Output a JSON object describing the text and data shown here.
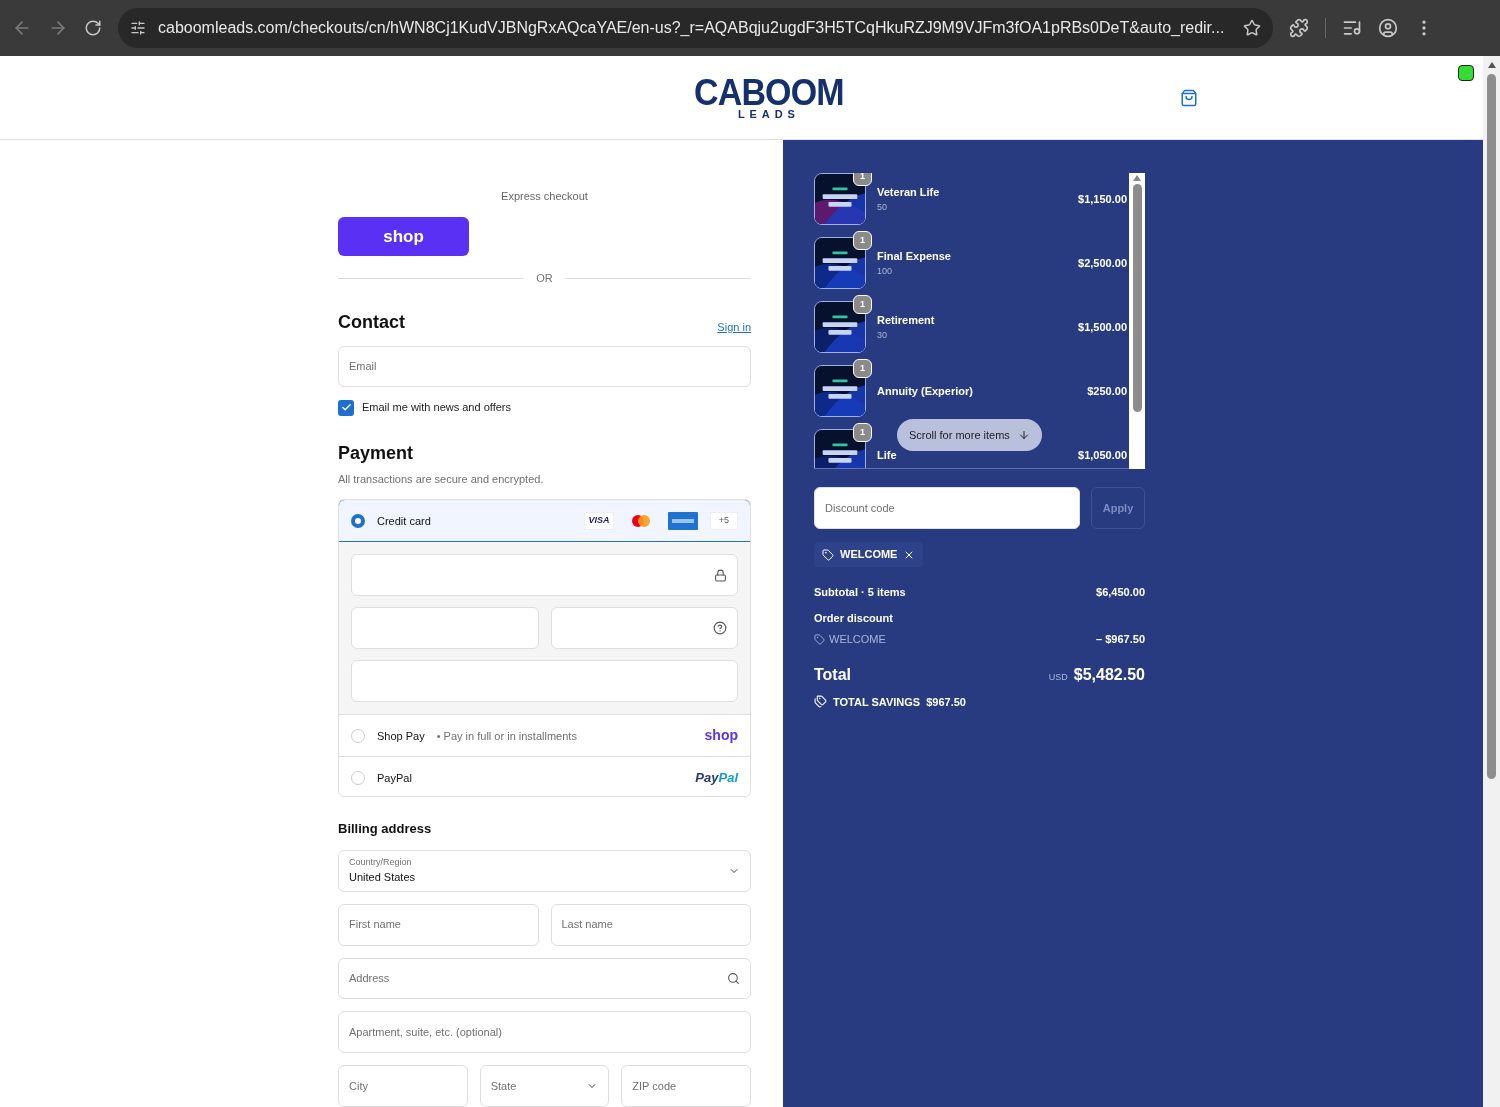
{
  "browser": {
    "url": "caboomleads.com/checkouts/cn/hWN8Cj1KudVJBNgRxAQcaYAE/en-us?_r=AQABqju2ugdF3H5TCqHkuRZJ9M9VJFm3fOA1pRBs0DeT&auto_redir..."
  },
  "header": {
    "logo_top": "CABOOM",
    "logo_bottom": "LEADS"
  },
  "express": {
    "label": "Express checkout",
    "button": "shop",
    "divider": "OR"
  },
  "contact": {
    "title": "Contact",
    "sign_in": "Sign in",
    "email_placeholder": "Email",
    "newsletter": {
      "label": "Email me with news and offers",
      "checked": true
    }
  },
  "payment": {
    "title": "Payment",
    "subtitle": "All transactions are secure and encrypted.",
    "methods": [
      {
        "kind": "card",
        "label": "Credit card",
        "selected": true,
        "visa": "VISA",
        "more": "+5"
      },
      {
        "kind": "shoppay",
        "label": "Shop Pay",
        "note": "• Pay in full or in installments",
        "logo": "shop",
        "selected": false
      },
      {
        "kind": "paypal",
        "label": "PayPal",
        "logo_a": "Pay",
        "logo_b": "Pal",
        "selected": false
      }
    ]
  },
  "billing": {
    "title": "Billing address",
    "country_label": "Country/Region",
    "country": "United States",
    "first_name": "First name",
    "last_name": "Last name",
    "address": "Address",
    "apartment": "Apartment, suite, etc. (optional)",
    "city": "City",
    "state": "State",
    "zip": "ZIP code"
  },
  "summary": {
    "items": [
      {
        "name": "Veteran Life",
        "detail": "50",
        "price": "$1,150.00",
        "quantity": "1"
      },
      {
        "name": "Final Expense",
        "detail": "100",
        "price": "$2,500.00",
        "quantity": "1"
      },
      {
        "name": "Retirement",
        "detail": "30",
        "price": "$1,500.00",
        "quantity": "1"
      },
      {
        "name": "Annuity (Experior)",
        "price": "$250.00",
        "quantity": "1"
      },
      {
        "name": "Life",
        "price": "$1,050.00",
        "quantity": "1"
      }
    ],
    "scroll_hint": "Scroll for more items",
    "discount_placeholder": "Discount code",
    "apply": "Apply",
    "applied_code": "WELCOME",
    "subtotal_label": "Subtotal · 5 items",
    "subtotal": "$6,450.00",
    "discount_label": "Order discount",
    "discount_code": "WELCOME",
    "discount_amount": "– $967.50",
    "total_label": "Total",
    "currency": "USD",
    "total": "$5,482.50",
    "savings_label": "TOTAL SAVINGS",
    "savings": "$967.50"
  }
}
